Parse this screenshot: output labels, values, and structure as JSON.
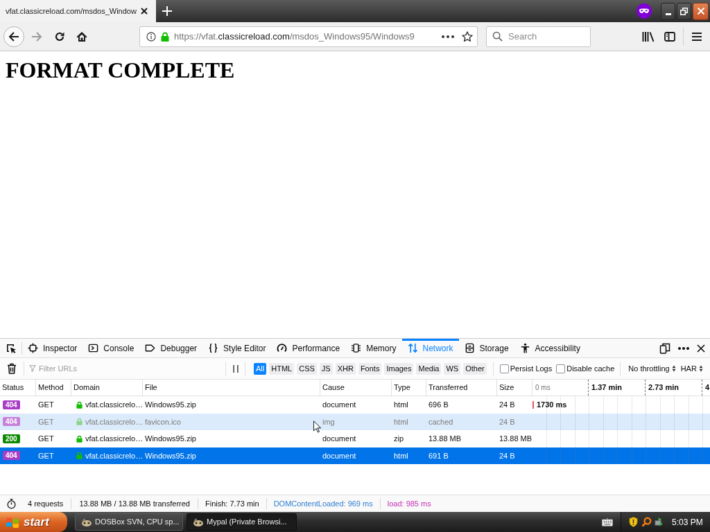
{
  "browser": {
    "tabs": [
      {
        "title": "vfat.classicreload.com/msdos_Window",
        "selected": true
      }
    ],
    "url": [
      {
        "text": "https://vfat.",
        "emphasis": false
      },
      {
        "text": "classicreload.com",
        "emphasis": true
      },
      {
        "text": "/msdos_Windows95/Windows9",
        "emphasis": false
      }
    ],
    "search": {
      "placeholder": "Search"
    }
  },
  "page": {
    "heading": "FORMAT COMPLETE"
  },
  "devtools": {
    "tabs": [
      {
        "label": "Inspector",
        "selected": false
      },
      {
        "label": "Console",
        "selected": false
      },
      {
        "label": "Debugger",
        "selected": false
      },
      {
        "label": "Style Editor",
        "selected": false
      },
      {
        "label": "Performance",
        "selected": false
      },
      {
        "label": "Memory",
        "selected": false
      },
      {
        "label": "Network",
        "selected": true
      },
      {
        "label": "Storage",
        "selected": false
      },
      {
        "label": "Accessibility",
        "selected": false
      }
    ],
    "filter": {
      "placeholder": "Filter URLs"
    },
    "type_filters": [
      {
        "label": "All",
        "selected": true
      },
      {
        "label": "HTML",
        "selected": false
      },
      {
        "label": "CSS",
        "selected": false
      },
      {
        "label": "JS",
        "selected": false
      },
      {
        "label": "XHR",
        "selected": false
      },
      {
        "label": "Fonts",
        "selected": false
      },
      {
        "label": "Images",
        "selected": false
      },
      {
        "label": "Media",
        "selected": false
      },
      {
        "label": "WS",
        "selected": false
      },
      {
        "label": "Other",
        "selected": false
      }
    ],
    "options": [
      {
        "label": "Persist Logs",
        "checked": false
      },
      {
        "label": "Disable cache",
        "checked": false
      }
    ],
    "dropdowns": [
      "No throttling",
      "HAR"
    ]
  },
  "table": {
    "columns": [
      "Status",
      "Method",
      "Domain",
      "File",
      "Cause",
      "Type",
      "Transferred",
      "Size"
    ],
    "timeline_ticks": [
      "0 ms",
      "1.37 min",
      "2.73 min",
      "4"
    ],
    "rows": [
      {
        "status": "404",
        "color": "#a93dc6",
        "method": "GET",
        "domain": "vfat.classicrelo…",
        "file": "Windows95.zip",
        "cause": "document",
        "type": "html",
        "transferred": "696 B",
        "size": "24 B",
        "timing": "1730 ms",
        "selected": false,
        "hovered": false,
        "cached": false
      },
      {
        "status": "404",
        "color": "#c681d9",
        "method": "GET",
        "domain": "vfat.classicrelo…",
        "file": "favicon.ico",
        "cause": "img",
        "type": "html",
        "transferred": "cached",
        "size": "24 B",
        "selected": false,
        "hovered": true,
        "cached": true
      },
      {
        "status": "200",
        "color": "#0c8a00",
        "method": "GET",
        "domain": "vfat.classicrelo…",
        "file": "Windows95.zip",
        "cause": "document",
        "type": "zip",
        "transferred": "13.88 MB",
        "size": "13.88 MB",
        "selected": false,
        "hovered": false,
        "cached": false
      },
      {
        "status": "404",
        "color": "#a93dc6",
        "method": "GET",
        "domain": "vfat.classicrelo…",
        "file": "Windows95.zip",
        "cause": "document",
        "type": "html",
        "transferred": "691 B",
        "size": "24 B",
        "selected": true,
        "hovered": false,
        "cached": false
      }
    ]
  },
  "status_bar": {
    "requests": "4 requests",
    "transferred": "13.88 MB / 13.88 MB transferred",
    "finish": "Finish: 7.73 min",
    "dom_content_loaded": "DOMContentLoaded: 969 ms",
    "load": "load: 985 ms"
  },
  "taskbar": {
    "start": "start",
    "tasks": [
      {
        "label": "DOSBox SVN, CPU sp...",
        "selected": false
      },
      {
        "label": "Mypal (Private Browsi...",
        "selected": true
      }
    ],
    "clock": "5:03 PM"
  }
}
